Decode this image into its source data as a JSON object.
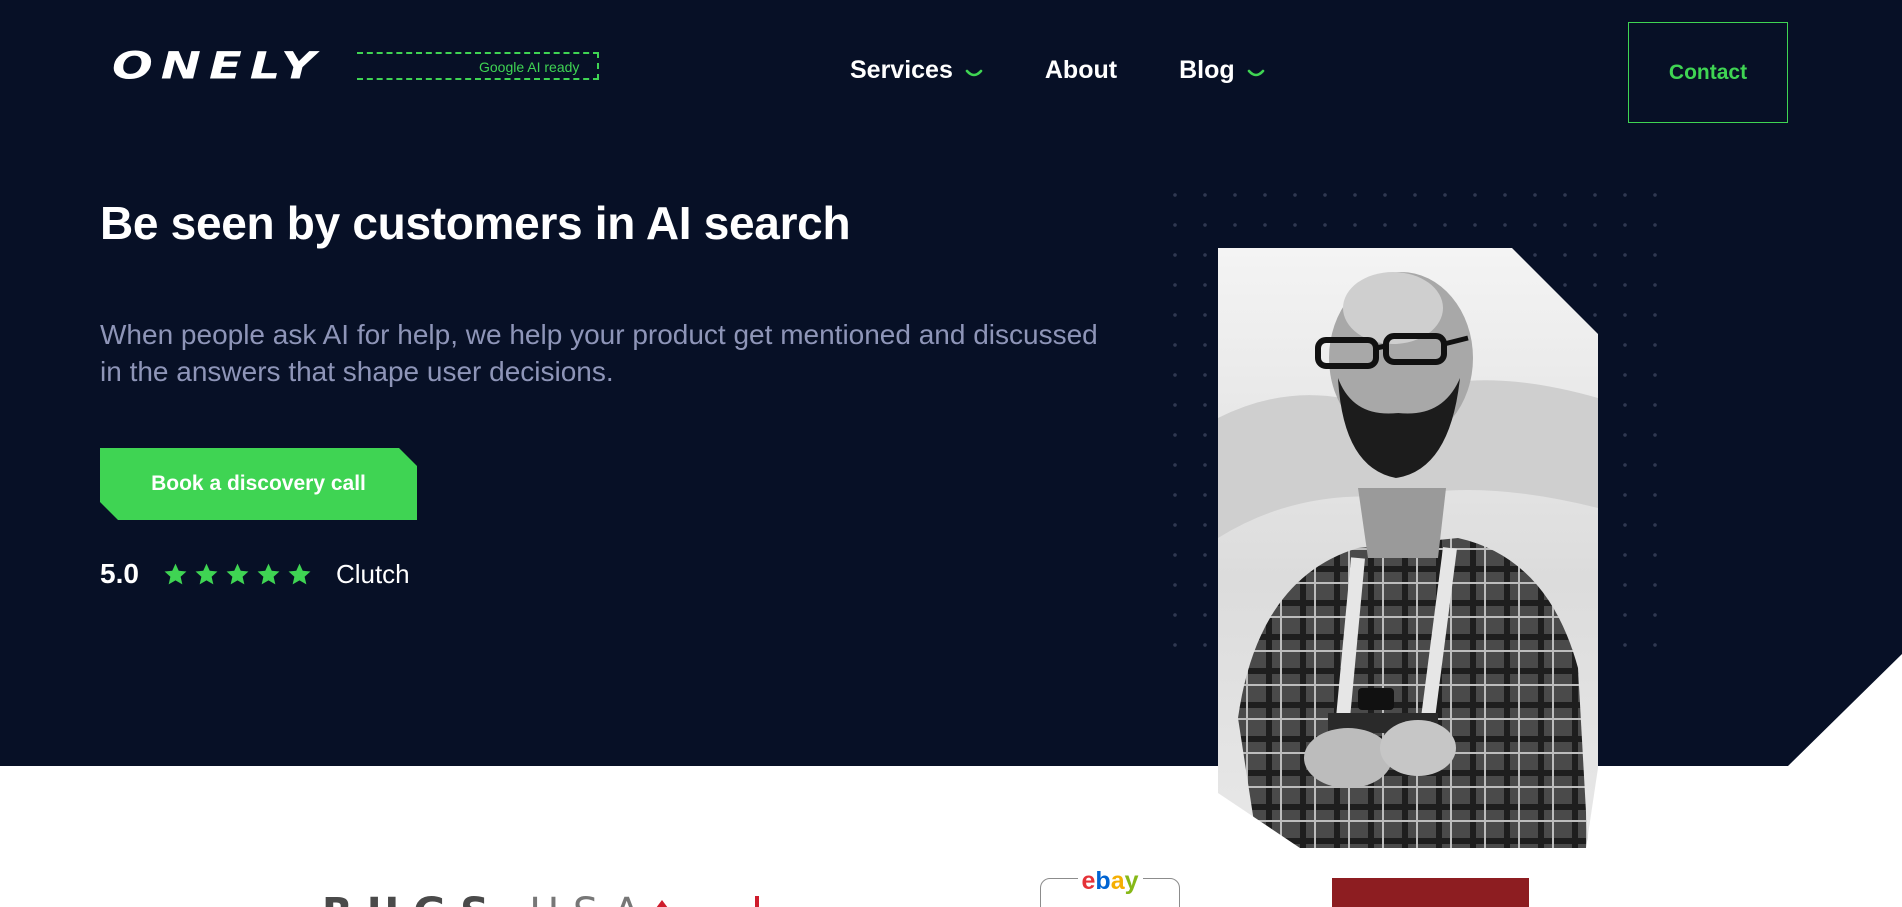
{
  "header": {
    "logo_text": "ONELY",
    "logo_badge": "Google AI ready",
    "nav": [
      {
        "label": "Services",
        "has_dropdown": true
      },
      {
        "label": "About",
        "has_dropdown": false
      },
      {
        "label": "Blog",
        "has_dropdown": true
      }
    ],
    "contact_label": "Contact"
  },
  "hero": {
    "headline": "Be seen by customers in AI search",
    "subtext": "When people ask AI for help, we help your product get mentioned and discussed in the answers that shape user decisions.",
    "cta_label": "Book a discovery call",
    "rating": {
      "score": "5.0",
      "stars": 5,
      "source": "Clutch"
    }
  },
  "client_logos": [
    {
      "name": "rugs-usa-logo",
      "text_main": "RUGS",
      "text_sub": "USA"
    },
    {
      "name": "red-logo"
    },
    {
      "name": "ebay-logo",
      "text": "ebay"
    },
    {
      "name": "maroon-logo"
    }
  ],
  "colors": {
    "hero_bg": "#071026",
    "accent": "#3fd453",
    "subtext": "#8e95b8",
    "white": "#ffffff"
  }
}
